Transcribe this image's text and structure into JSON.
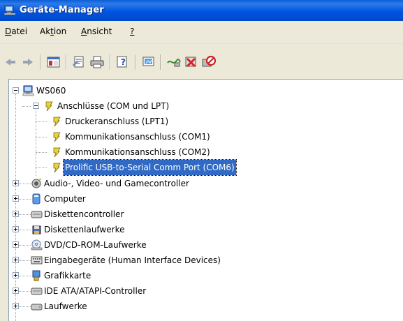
{
  "window": {
    "title": "Geräte-Manager"
  },
  "menu": {
    "items": [
      {
        "label": "Datei",
        "access_key": "D"
      },
      {
        "label": "Aktion",
        "access_key": "t"
      },
      {
        "label": "Ansicht",
        "access_key": "A"
      },
      {
        "label": "?",
        "access_key": "?"
      }
    ]
  },
  "toolbar": {
    "buttons": [
      "back-arrow-icon",
      "forward-arrow-icon",
      "console-tree-icon",
      "properties-icon",
      "print-icon",
      "help-icon",
      "update-driver-icon",
      "scan-hardware-icon",
      "uninstall-icon",
      "disable-icon"
    ]
  },
  "tree": {
    "root": "WS060",
    "ports": "Anschlüsse (COM und LPT)",
    "port_items": [
      "Druckeranschluss (LPT1)",
      "Kommunikationsanschluss (COM1)",
      "Kommunikationsanschluss (COM2)",
      "Prolific USB-to-Serial Comm Port (COM6)"
    ],
    "categories": [
      "Audio-, Video- und Gamecontroller",
      "Computer",
      "Diskettencontroller",
      "Diskettenlaufwerke",
      "DVD/CD-ROM-Laufwerke",
      "Eingabegeräte (Human Interface Devices)",
      "Grafikkarte",
      "IDE ATA/ATAPI-Controller",
      "Laufwerke"
    ]
  }
}
